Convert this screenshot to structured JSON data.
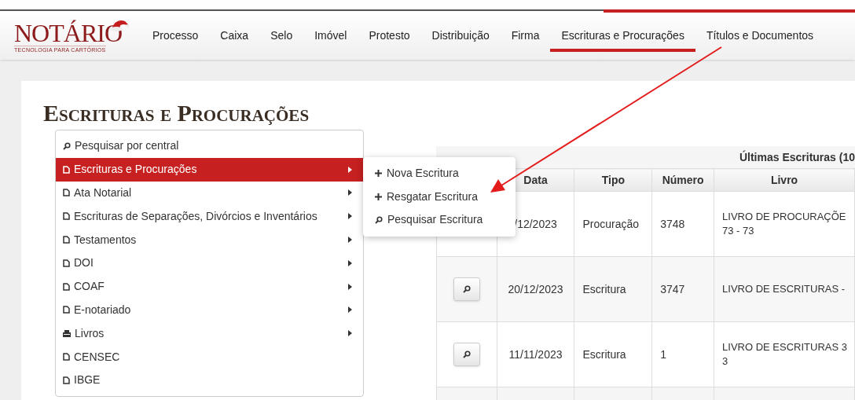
{
  "logo": {
    "name": "NOTÁRIO",
    "tagline": "TECNOLOGIA PARA CARTÓRIOS"
  },
  "nav": [
    {
      "label": "Processo",
      "selected": false
    },
    {
      "label": "Caixa",
      "selected": false
    },
    {
      "label": "Selo",
      "selected": false
    },
    {
      "label": "Imóvel",
      "selected": false
    },
    {
      "label": "Protesto",
      "selected": false
    },
    {
      "label": "Distribuição",
      "selected": false
    },
    {
      "label": "Firma",
      "selected": false
    },
    {
      "label": "Escrituras e Procurações",
      "selected": true
    },
    {
      "label": "Títulos e Documentos",
      "selected": false
    }
  ],
  "page_title": "Escrituras e Procurações",
  "menu": [
    {
      "label": "Pesquisar por central",
      "kind": "search",
      "submenu": false,
      "selected": false
    },
    {
      "label": "Escrituras e Procurações",
      "kind": "doc",
      "submenu": true,
      "selected": true
    },
    {
      "label": "Ata Notarial",
      "kind": "doc",
      "submenu": true,
      "selected": false
    },
    {
      "label": "Escrituras de Separações, Divórcios e Inventários",
      "kind": "doc",
      "submenu": true,
      "selected": false
    },
    {
      "label": "Testamentos",
      "kind": "doc",
      "submenu": true,
      "selected": false
    },
    {
      "label": "DOI",
      "kind": "doc",
      "submenu": true,
      "selected": false
    },
    {
      "label": "COAF",
      "kind": "doc",
      "submenu": true,
      "selected": false
    },
    {
      "label": "E-notariado",
      "kind": "doc",
      "submenu": true,
      "selected": false
    },
    {
      "label": "Livros",
      "kind": "print",
      "submenu": true,
      "selected": false
    },
    {
      "label": "CENSEC",
      "kind": "doc",
      "submenu": false,
      "selected": false
    },
    {
      "label": "IBGE",
      "kind": "doc",
      "submenu": false,
      "selected": false
    }
  ],
  "submenu": [
    {
      "label": "Nova Escritura",
      "kind": "plus"
    },
    {
      "label": "Resgatar Escritura",
      "kind": "plus"
    },
    {
      "label": "Pesquisar Escritura",
      "kind": "search"
    }
  ],
  "table": {
    "title": "Últimas Escrituras (10",
    "columns": [
      "Data",
      "Tipo",
      "Número",
      "Livro"
    ],
    "rows": [
      {
        "button": false,
        "data": "/12/2023",
        "tipo": "Procuração",
        "numero": "3748",
        "livro": [
          "LIVRO DE PROCURAÇÕE",
          "73 - 73"
        ]
      },
      {
        "button": true,
        "data": "20/12/2023",
        "tipo": "Escritura",
        "numero": "3747",
        "livro": [
          "LIVRO DE ESCRITURAS -"
        ]
      },
      {
        "button": true,
        "data": "11/11/2023",
        "tipo": "Escritura",
        "numero": "1",
        "livro": [
          "LIVRO DE ESCRITURAS 3",
          "3"
        ]
      }
    ]
  }
}
